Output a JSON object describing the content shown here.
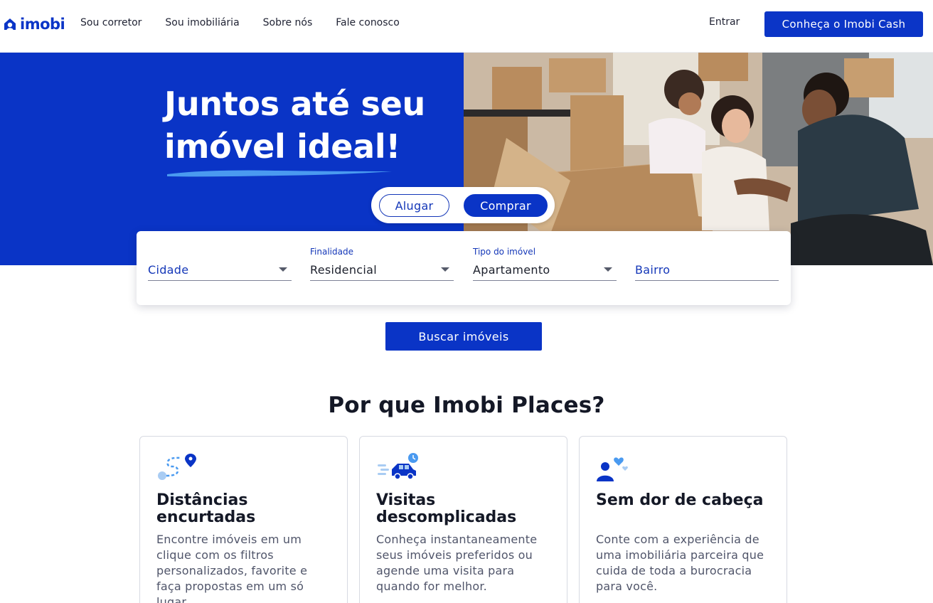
{
  "header": {
    "logo_text": "imobi",
    "nav": [
      "Sou corretor",
      "Sou imobiliária",
      "Sobre nós",
      "Fale conosco"
    ],
    "login_label": "Entrar",
    "cta_label": "Conheça o Imobi Cash"
  },
  "hero": {
    "title_line1": "Juntos até seu",
    "title_line2": "imóvel ideal!",
    "toggle_rent": "Alugar",
    "toggle_buy": "Comprar",
    "toggle_selected": "Comprar"
  },
  "search": {
    "city": {
      "label": "",
      "value": "Cidade"
    },
    "purpose": {
      "label": "Finalidade",
      "value": "Residencial"
    },
    "type": {
      "label": "Tipo do imóvel",
      "value": "Apartamento"
    },
    "district": {
      "label": "",
      "value": "Bairro"
    },
    "button_label": "Buscar imóveis"
  },
  "why": {
    "title": "Por que Imobi Places?",
    "features": [
      {
        "icon": "route-pin-icon",
        "title": "Distâncias encurtadas",
        "text": "Encontre imóveis em um clique com os filtros personalizados, favorite e faça propostas em um só lugar."
      },
      {
        "icon": "car-clock-icon",
        "title": "Visitas descomplicadas",
        "text": "Conheça instantaneamente seus imóveis preferidos ou agende uma visita para quando for melhor."
      },
      {
        "icon": "person-hearts-icon",
        "title": "Sem dor de cabeça",
        "text": "Conte com a experiência de uma imobiliária parceira que cuida de toda a burocracia para você."
      }
    ]
  },
  "colors": {
    "brand_blue": "#0a34c6",
    "accent_light_blue": "#4a9af0"
  }
}
